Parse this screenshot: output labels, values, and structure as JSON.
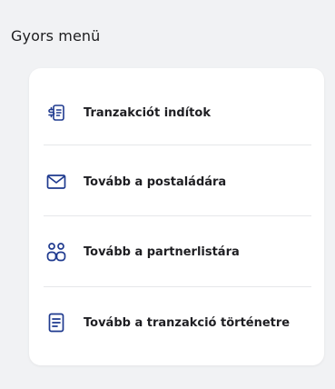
{
  "quick_menu": {
    "title": "Gyors menü",
    "items": [
      {
        "label": "Tranzakciót indítok",
        "icon": "transfer-receipt-icon"
      },
      {
        "label": "Tovább a postaládára",
        "icon": "mail-envelope-icon"
      },
      {
        "label": "Tovább a partnerlistára",
        "icon": "contacts-people-icon"
      },
      {
        "label": "Tovább a tranzakció történetre",
        "icon": "document-list-icon"
      }
    ]
  },
  "colors": {
    "background": "#f1f2f4",
    "card": "#ffffff",
    "icon_blue": "#1f3a8f",
    "text": "#1e1e22"
  }
}
